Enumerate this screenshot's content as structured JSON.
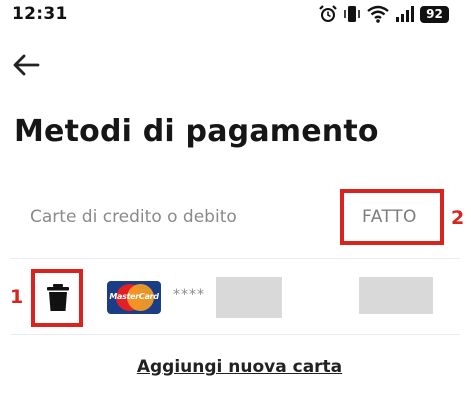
{
  "status_bar": {
    "time": "12:31",
    "battery": "92",
    "icons": [
      "alarm-icon",
      "vibrate-icon",
      "wifi-icon",
      "signal-icon",
      "battery-icon"
    ]
  },
  "header": {
    "back_icon": "arrow-left-icon",
    "title": "Metodi di pagamento"
  },
  "cards_section": {
    "label": "Carte di credito o debito",
    "done_label": "FATTO",
    "cards": [
      {
        "brand": "MasterCard",
        "masked_prefix": "****",
        "delete_icon": "trash-icon"
      }
    ]
  },
  "annotations": {
    "callout_delete": "1",
    "callout_done": "2",
    "highlight_color": "#d9231d"
  },
  "add_card_label": "Aggiungi nuova carta",
  "colors": {
    "mastercard_blue": "#1a3d86",
    "mastercard_red": "#e31f26",
    "mastercard_yellow": "#f59d24"
  }
}
